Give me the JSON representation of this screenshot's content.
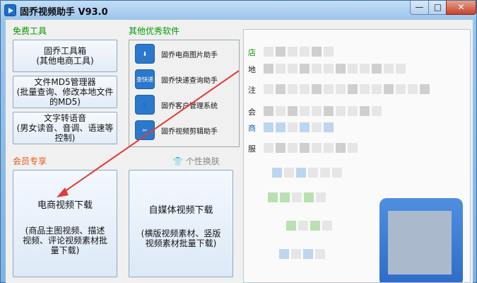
{
  "window": {
    "title": "固乔视频助手 V93.0",
    "controls": {
      "minimize": "—",
      "maximize": "□",
      "close": "✕"
    }
  },
  "free_tools": {
    "label": "免费工具",
    "buttons": [
      {
        "line1": "固乔工具箱",
        "line2": "(其他电商工具)"
      },
      {
        "line1": "文件MD5管理器",
        "line2": "(批量查询、修改本地文件",
        "line3": "的MD5)"
      },
      {
        "line1": "文字转语音",
        "line2": "(男女读音、音调、语速等",
        "line3": "控制)"
      }
    ]
  },
  "other_software": {
    "label": "其他优秀软件",
    "items": [
      {
        "name": "固乔电商图片助手",
        "icon": "download-icon",
        "icon_text": "⬇"
      },
      {
        "name": "固乔快递查询助手",
        "icon": "express-search-icon",
        "icon_text": "查快递"
      },
      {
        "name": "固乔客户管理系统",
        "icon": "customer-icon",
        "icon_text": "👤"
      },
      {
        "name": "固乔视频剪辑助手",
        "icon": "scissors-icon",
        "icon_text": "✂"
      }
    ]
  },
  "member": {
    "label": "会员专享",
    "skin_label": "个性换肤",
    "buttons": [
      {
        "title": "电商视频下载",
        "desc1": "(商品主图视频、描述",
        "desc2": "视频、评论视频素材批",
        "desc3": "量下载)"
      },
      {
        "title": "自媒体视频下载",
        "desc1": "(横版视频素材、竖版",
        "desc2": "视频素材批量下载)"
      }
    ]
  },
  "preview_side_chars": [
    "店",
    "地",
    "注",
    "会",
    "商",
    "服"
  ],
  "colors": {
    "free_label": "#009900",
    "member_label": "#e05a17",
    "arrow": "#e53935"
  }
}
